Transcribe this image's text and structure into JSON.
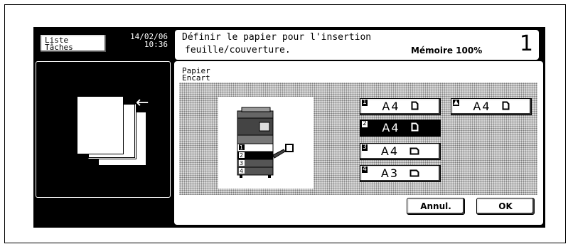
{
  "header": {
    "task_button": [
      "Liste",
      "Tâches"
    ],
    "date": "14/02/06",
    "time": "10:36",
    "message_line1": "Définir le papier pour l'insertion",
    "message_line2": "feuille/couverture.",
    "memory": "Mémoire 100%",
    "copies": "1"
  },
  "main": {
    "title_line1": "Papier",
    "title_line2": "Encart"
  },
  "trays": [
    {
      "num": "1",
      "label": "A4",
      "orientation": "portrait",
      "selected": false
    },
    {
      "num": "2",
      "label": "A4",
      "orientation": "portrait",
      "selected": true
    },
    {
      "num": "3",
      "label": "A4",
      "orientation": "landscape",
      "selected": false
    },
    {
      "num": "4",
      "label": "A3",
      "orientation": "landscape",
      "selected": false
    },
    {
      "num": "▲",
      "label": "A4",
      "orientation": "portrait",
      "selected": false
    }
  ],
  "machine_tray_labels": [
    "1",
    "2",
    "3",
    "4"
  ],
  "buttons": {
    "cancel": "Annul.",
    "ok": "OK"
  },
  "icons": {
    "paper_portrait": "paper-portrait-icon",
    "paper_landscape": "paper-landscape-icon",
    "insert_arrow": "arrow-left-icon"
  }
}
